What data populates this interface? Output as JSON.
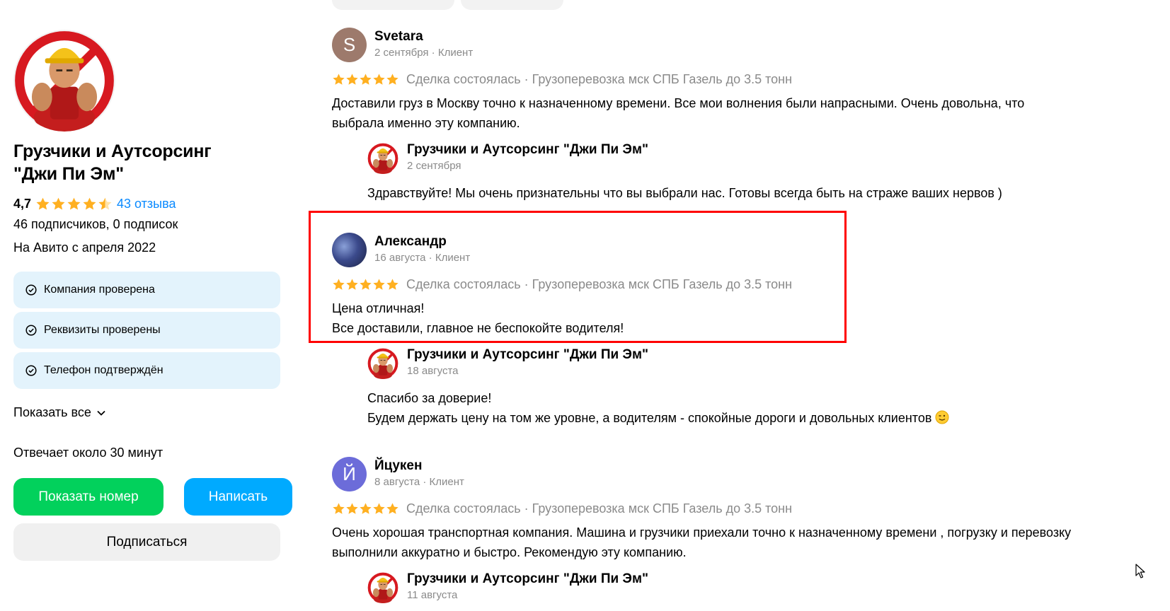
{
  "seller": {
    "name_line1": "Грузчики и Аутсорсинг",
    "name_line2": "\"Джи Пи Эм\"",
    "rating": "4,7",
    "rating_stars": 4.5,
    "reviews_link": "43 отзыва",
    "followers": "46 подписчиков, 0 подписок",
    "since": "На Авито с апреля 2022",
    "badges": [
      "Компания проверена",
      "Реквизиты проверены",
      "Телефон подтверждён"
    ],
    "show_all": "Показать все",
    "response_time": "Отвечает около 30 минут",
    "show_phone_button": "Показать номер",
    "write_button": "Написать",
    "subscribe_button": "Подписаться"
  },
  "reviews": [
    {
      "avatar_letter": "S",
      "avatar_color": "#9d7a6c",
      "author": "Svetara",
      "meta": "2 сентября · Клиент",
      "stars": 5,
      "deal": "Сделка состоялась · Грузоперевозка мск СПБ Газель до 3.5 тонн",
      "text_line1": "Доставили груз в Москву точно к назначенному времени. Все мои волнения были напрасными. Очень довольна, что",
      "text_line2": "выбрала именно эту компанию.",
      "reply": {
        "author": "Грузчики и Аутсорсинг \"Джи Пи Эм\"",
        "date": "2 сентября",
        "text_line1": "Здравствуйте! Мы очень признательны что вы выбрали нас. Готовы всегда быть на страже ваших нервов )"
      }
    },
    {
      "avatar_letter": "",
      "avatar_color": "#3b4a8c",
      "author": "Александр",
      "meta": "16 августа · Клиент",
      "stars": 5,
      "deal": "Сделка состоялась · Грузоперевозка мск СПБ Газель до 3.5 тонн",
      "text_line1": "Цена отличная!",
      "text_line2": "Все доставили, главное не беспокойте водителя!",
      "reply": {
        "author": "Грузчики и Аутсорсинг \"Джи Пи Эм\"",
        "date": "18 августа",
        "text_line1": "Спасибо за доверие!",
        "text_line2": "Будем держать цену на том же уровне, а водителям - спокойные дороги и довольных клиентов"
      }
    },
    {
      "avatar_letter": "Й",
      "avatar_color": "#6c6cd9",
      "author": "Йцукен",
      "meta": "8 августа · Клиент",
      "stars": 5,
      "deal": "Сделка состоялась · Грузоперевозка мск СПБ Газель до 3.5 тонн",
      "text_line1": "Очень хорошая транспортная компания. Машина и грузчики приехали точно к назначенному времени , погрузку и перевозку",
      "text_line2": "выполнили аккуратно и быстро. Рекомендую эту компанию.",
      "reply": {
        "author": "Грузчики и Аутсорсинг \"Джи Пи Эм\"",
        "date": "11 августа"
      }
    }
  ],
  "colors": {
    "star": "#ffb021",
    "link": "#0a8aff",
    "green_button": "#02d15c",
    "blue_button": "#00aaff",
    "badge_bg": "#e3f3fc",
    "highlight": "#ff0000"
  }
}
